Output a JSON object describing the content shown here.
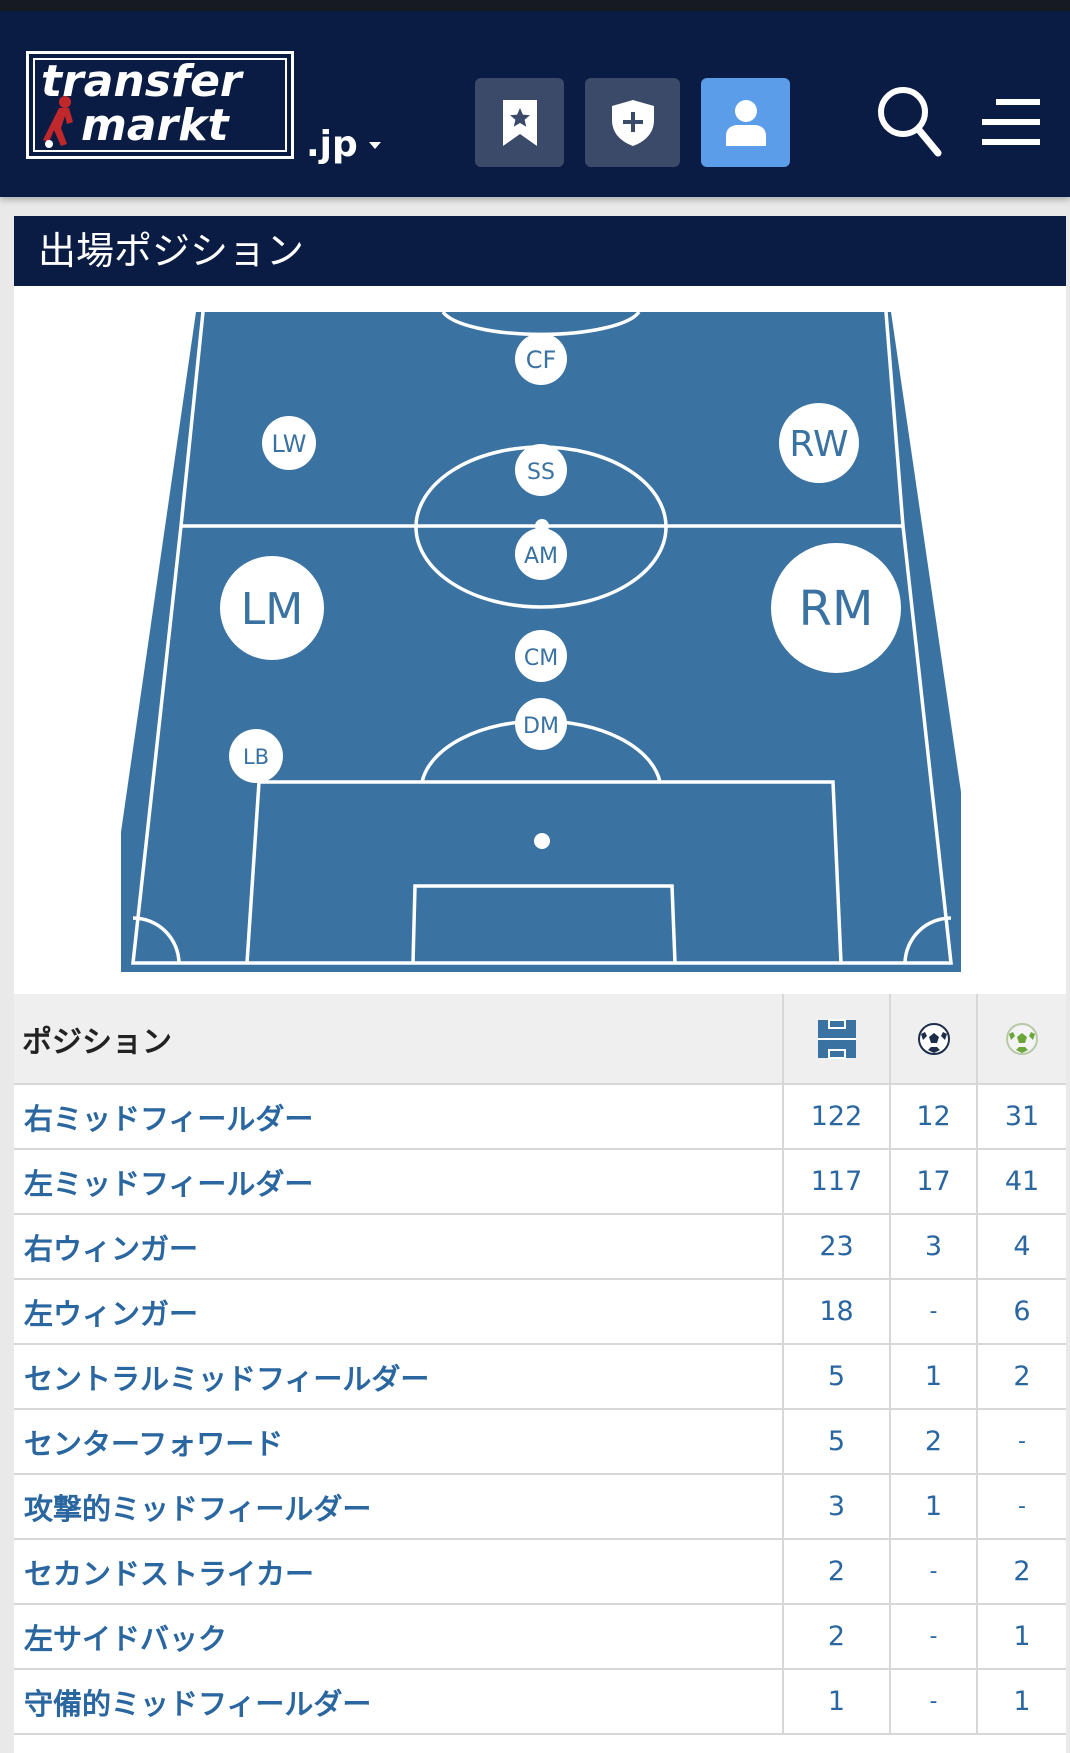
{
  "header": {
    "logo_line1": "transfer",
    "logo_line2": "markt",
    "domain": ".jp",
    "buttons": [
      "bookmark-star",
      "shield-plus",
      "user"
    ]
  },
  "section": {
    "title": "出場ポジション"
  },
  "pitch_positions": [
    {
      "code": "CF"
    },
    {
      "code": "LW"
    },
    {
      "code": "SS"
    },
    {
      "code": "RW"
    },
    {
      "code": "AM"
    },
    {
      "code": "LM"
    },
    {
      "code": "RM"
    },
    {
      "code": "CM"
    },
    {
      "code": "DM"
    },
    {
      "code": "LB"
    }
  ],
  "table": {
    "header_position": "ポジション",
    "header_icons": [
      "pitch-icon",
      "ball-icon",
      "assist-ball-icon"
    ],
    "rows": [
      {
        "name": "右ミッドフィールダー",
        "apps": "122",
        "goals": "12",
        "assists": "31"
      },
      {
        "name": "左ミッドフィールダー",
        "apps": "117",
        "goals": "17",
        "assists": "41"
      },
      {
        "name": "右ウィンガー",
        "apps": "23",
        "goals": "3",
        "assists": "4"
      },
      {
        "name": "左ウィンガー",
        "apps": "18",
        "goals": "-",
        "assists": "6"
      },
      {
        "name": "セントラルミッドフィールダー",
        "apps": "5",
        "goals": "1",
        "assists": "2"
      },
      {
        "name": "センターフォワード",
        "apps": "5",
        "goals": "2",
        "assists": "-"
      },
      {
        "name": "攻撃的ミッドフィールダー",
        "apps": "3",
        "goals": "1",
        "assists": "-"
      },
      {
        "name": "セカンドストライカー",
        "apps": "2",
        "goals": "-",
        "assists": "2"
      },
      {
        "name": "左サイドバック",
        "apps": "2",
        "goals": "-",
        "assists": "1"
      },
      {
        "name": "守備的ミッドフィールダー",
        "apps": "1",
        "goals": "-",
        "assists": "1"
      }
    ]
  },
  "colors": {
    "header_bg": "#0a1c44",
    "pitch": "#3a72a2",
    "link": "#2a66a0",
    "active_button": "#5b9de8"
  }
}
